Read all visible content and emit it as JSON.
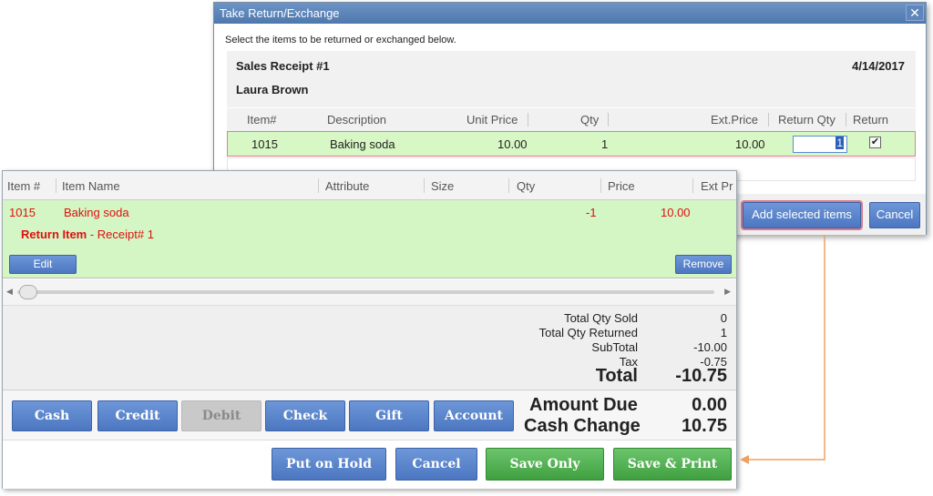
{
  "dialog": {
    "title": "Take Return/Exchange",
    "close_glyph": "✕",
    "instruction": "Select the items to be returned or exchanged below.",
    "receipt_no": "Sales Receipt #1",
    "receipt_date": "4/14/2017",
    "customer": "Laura Brown",
    "columns": [
      "Item#",
      "Description",
      "Unit Price",
      "Qty",
      "Ext.Price",
      "Return Qty",
      "Return"
    ],
    "row": {
      "item_no": "1015",
      "description": "Baking soda",
      "unit_price": "10.00",
      "qty": "1",
      "ext_price": "10.00",
      "return_qty": "1",
      "return_checked": "✔"
    },
    "add_button": "Add selected items",
    "cancel_button": "Cancel"
  },
  "pos": {
    "columns": [
      "Item #",
      "Item Name",
      "Attribute",
      "Size",
      "Qty",
      "Price",
      "Ext Pr"
    ],
    "item": {
      "item_no": "1015",
      "name": "Baking soda",
      "qty": "-1",
      "price": "10.00",
      "return_label": "Return Item",
      "return_receipt": " - Receipt# 1"
    },
    "edit_button": "Edit",
    "remove_button": "Remove",
    "totals": {
      "qty_sold_label": "Total Qty Sold",
      "qty_sold": "0",
      "qty_returned_label": "Total Qty Returned",
      "qty_returned": "1",
      "subtotal_label": "SubTotal",
      "subtotal": "-10.00",
      "tax_label": "Tax",
      "tax": "-0.75",
      "total_label": "Total",
      "total": "-10.75"
    },
    "payments": [
      "Cash",
      "Credit",
      "Debit",
      "Check",
      "Gift",
      "Account"
    ],
    "amount_due_label": "Amount Due",
    "amount_due": "0.00",
    "cash_change_label": "Cash Change",
    "cash_change": "10.75",
    "actions": {
      "hold": "Put on Hold",
      "cancel": "Cancel",
      "save_only": "Save Only",
      "save_print": "Save & Print"
    }
  },
  "colors": {
    "accent_blue": "#4c76c0",
    "row_green": "#d4f5c4",
    "red_text": "#e01010",
    "save_green": "#40a040",
    "connector_orange": "#f0a060"
  }
}
